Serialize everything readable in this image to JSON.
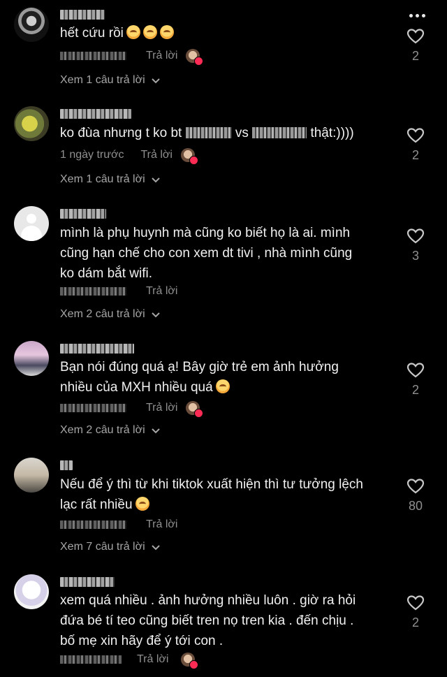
{
  "comments": [
    {
      "text": "hết cứu rồi",
      "emoji_count": 3,
      "date": "",
      "reply_label": "Trả lời",
      "creator_liked": true,
      "view_replies": "Xem 1 câu trả lời",
      "likes": "2"
    },
    {
      "text_parts": [
        "ko đùa nhưng t ko bt ",
        " vs ",
        " thật:))))"
      ],
      "date": "1 ngày trước",
      "reply_label": "Trả lời",
      "creator_liked": true,
      "view_replies": "Xem 1 câu trả lời",
      "likes": "2"
    },
    {
      "lines": [
        "mình là phụ huynh mà cũng ko biết họ là ai. mình",
        "cũng hạn chế cho con xem dt tivi , nhà mình cũng",
        "ko dám bắt wifi."
      ],
      "date": "",
      "reply_label": "Trả lời",
      "creator_liked": false,
      "view_replies": "Xem 2 câu trả lời",
      "likes": "3"
    },
    {
      "lines": [
        "Bạn nói đúng quá ạ! Bây giờ trẻ em ảnh hưởng",
        "nhiều của MXH nhiều quá"
      ],
      "date": "",
      "reply_label": "Trả lời",
      "creator_liked": true,
      "view_replies": "Xem 2 câu trả lời",
      "likes": "2"
    },
    {
      "lines": [
        "Nếu để ý thì từ khi tiktok xuất hiện thì tư tưởng lệch",
        "lạc rất nhiều"
      ],
      "date": "",
      "reply_label": "Trả lời",
      "creator_liked": false,
      "view_replies": "Xem 7 câu trả lời",
      "likes": "80"
    },
    {
      "lines": [
        "xem quá nhiều . ảnh hưởng nhiều luôn . giờ ra hỏi",
        "đứa bé tí teo cũng biết tren nọ tren kia . đến chịu .",
        "bố mẹ xin hãy để ý tới con ."
      ],
      "date": "",
      "reply_label": "Trả lời",
      "creator_liked": true,
      "view_replies": "",
      "likes": "2"
    }
  ],
  "colors": {
    "background": "#000000",
    "text": "#f1f1f1",
    "muted": "#8f8f8f",
    "creator_badge": "#fe2c55"
  },
  "icons": [
    "more-icon",
    "heart-outline-icon",
    "chevron-down-icon"
  ]
}
